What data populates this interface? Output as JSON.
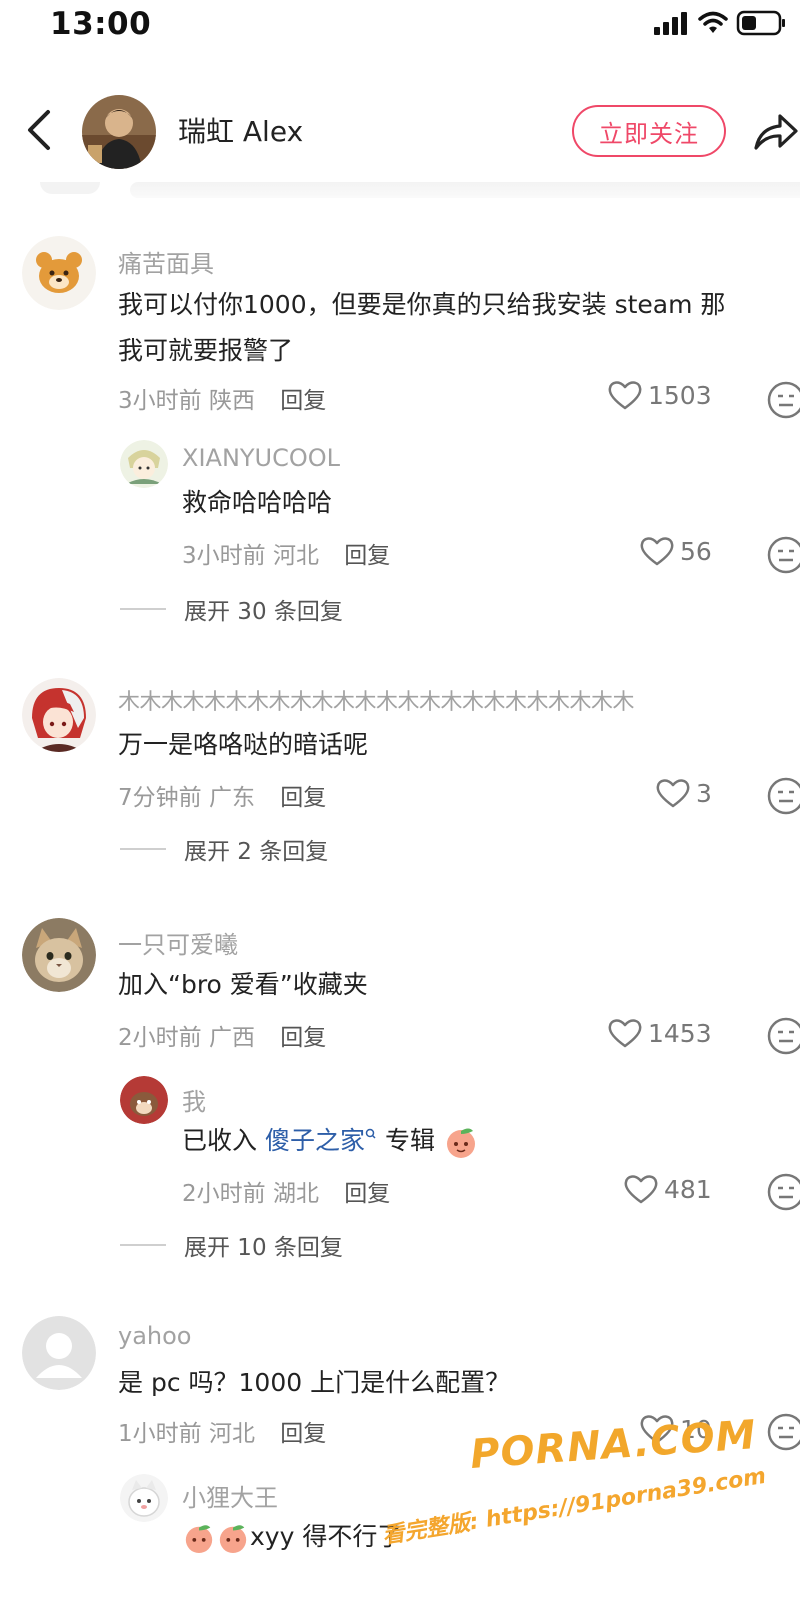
{
  "status_bar": {
    "time": "13:00"
  },
  "header": {
    "author_name": "瑞虹 Alex",
    "follow_label": "立即关注"
  },
  "comments": [
    {
      "user": "痛苦面具",
      "text_line1": "我可以付你1000，但要是你真的只给我安装 steam 那",
      "text_line2": "我可就要报警了",
      "time": "3小时前",
      "location": "陕西",
      "reply_label": "回复",
      "likes": "1503",
      "replies": [
        {
          "user": "XIANYUCOOL",
          "text": "救命哈哈哈哈",
          "time": "3小时前",
          "location": "河北",
          "reply_label": "回复",
          "likes": "56"
        }
      ],
      "expand_label": "展开 30 条回复"
    },
    {
      "user": "木木木木木木木木木木木木木木木木木木木木木木木木",
      "text": "万一是咯咯哒的暗话呢",
      "time": "7分钟前",
      "location": "广东",
      "reply_label": "回复",
      "likes": "3",
      "expand_label": "展开 2 条回复"
    },
    {
      "user": "一只可爱曦",
      "text": "加入“bro 爱看”收藏夹",
      "time": "2小时前",
      "location": "广西",
      "reply_label": "回复",
      "likes": "1453",
      "replies": [
        {
          "user": "我",
          "text_prefix": "已收入",
          "text_link": "傻子之家",
          "text_suffix": "专辑",
          "time": "2小时前",
          "location": "湖北",
          "reply_label": "回复",
          "likes": "481"
        }
      ],
      "expand_label": "展开 10 条回复"
    },
    {
      "user": "yahoo",
      "text": "是 pc 吗？1000 上门是什么配置？",
      "time": "1小时前",
      "location": "河北",
      "reply_label": "回复",
      "likes": "10",
      "replies": [
        {
          "user": "小狸大王",
          "text": "xyy 得不行了"
        }
      ]
    }
  ],
  "watermark": {
    "brand": "PORNA.COM",
    "url_line": "看完整版: https://91porna39.com"
  },
  "colors": {
    "accent": "#ef4868",
    "link": "#2d5ea8",
    "meta": "#999999",
    "watermark": "#f2a72b"
  }
}
